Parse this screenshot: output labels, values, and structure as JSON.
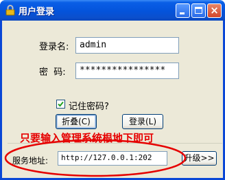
{
  "window": {
    "title": "用户登录",
    "close_glyph": "×"
  },
  "form": {
    "username_label": "登录名:",
    "username_value": "admin",
    "password_label": "密  码:",
    "password_value": "****************",
    "remember_label": "记住密码?",
    "remember_checked": true
  },
  "buttons": {
    "collapse_label": "折叠(C)",
    "login_label": "登录(L)",
    "upgrade_label": "升级>>"
  },
  "hint_text": "只要输入管理系统根地下即可",
  "server": {
    "label": "服务地址:",
    "value": "http://127.0.0.1:202"
  },
  "colors": {
    "hint": "#E60000",
    "titlebar": "#0453DB",
    "annotation_ellipse": "#E60000"
  }
}
